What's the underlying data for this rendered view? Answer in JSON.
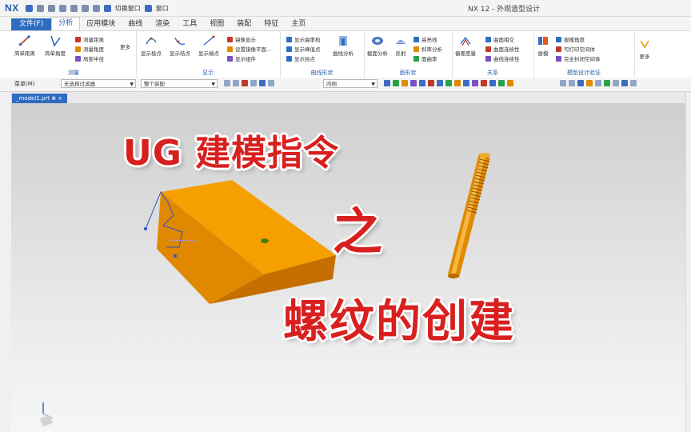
{
  "titlebar": {
    "logo": "NX",
    "quick_access": [
      "切换窗口",
      "窗口"
    ],
    "window_title": "NX 12 - 外观造型设计"
  },
  "tabs": [
    "文件(F)",
    "分析",
    "应用模块",
    "曲线",
    "渲染",
    "工具",
    "视图",
    "装配",
    "特征",
    "主页"
  ],
  "ribbon": {
    "groups": {
      "measure": "测量",
      "display": "显示",
      "curve_shape": "曲线形状",
      "face_shape": "面形状",
      "relation": "关系",
      "check": "模型设计验证"
    },
    "buttons": {
      "simple_distance": "简单距离",
      "simple_angle": "简单角度",
      "measure_distance": "测量距离",
      "measure_angle": "测量角度",
      "local_radius": "局部半径",
      "more1": "更多",
      "show_extreme": "显示极点",
      "show_knots": "显示结点",
      "show_endpoints": "显示端点",
      "mirror_show": "镜像显示",
      "set_mirror_plane": "设置镜像平面...",
      "show_group": "显示组件",
      "show_curvature_comb": "显示曲率梳",
      "show_peak": "显示峰值点",
      "show_inflection": "显示拐点",
      "curve_analysis": "曲线分析",
      "section_analysis": "截面分析",
      "reflection": "反射",
      "highlight_line": "高亮线",
      "slope_analysis": "斜率分析",
      "face_curvature": "面曲率",
      "deviation_measure": "偏差度量",
      "face_intersect": "曲面相交",
      "face_continuity": "曲面连续性",
      "curve_continuity": "曲线连续性",
      "draft": "拔模",
      "draft_angle": "拔模角度",
      "printable_space": "可打印空间体",
      "security_space": "完全封闭空间体",
      "more2": "更多"
    }
  },
  "toolbar": {
    "menu": "菜单(M)",
    "filter": "无选择过滤器",
    "scope": "整个装配",
    "inside": "内侧"
  },
  "document": {
    "tab": "_model1.prt"
  },
  "overlay": {
    "line1": "UG 建模指令",
    "line2": "之",
    "line3": "螺纹的创建"
  },
  "colors": {
    "accent": "#2e6cc0",
    "overlay_red": "#d8201f",
    "part_orange": "#f5a000"
  }
}
